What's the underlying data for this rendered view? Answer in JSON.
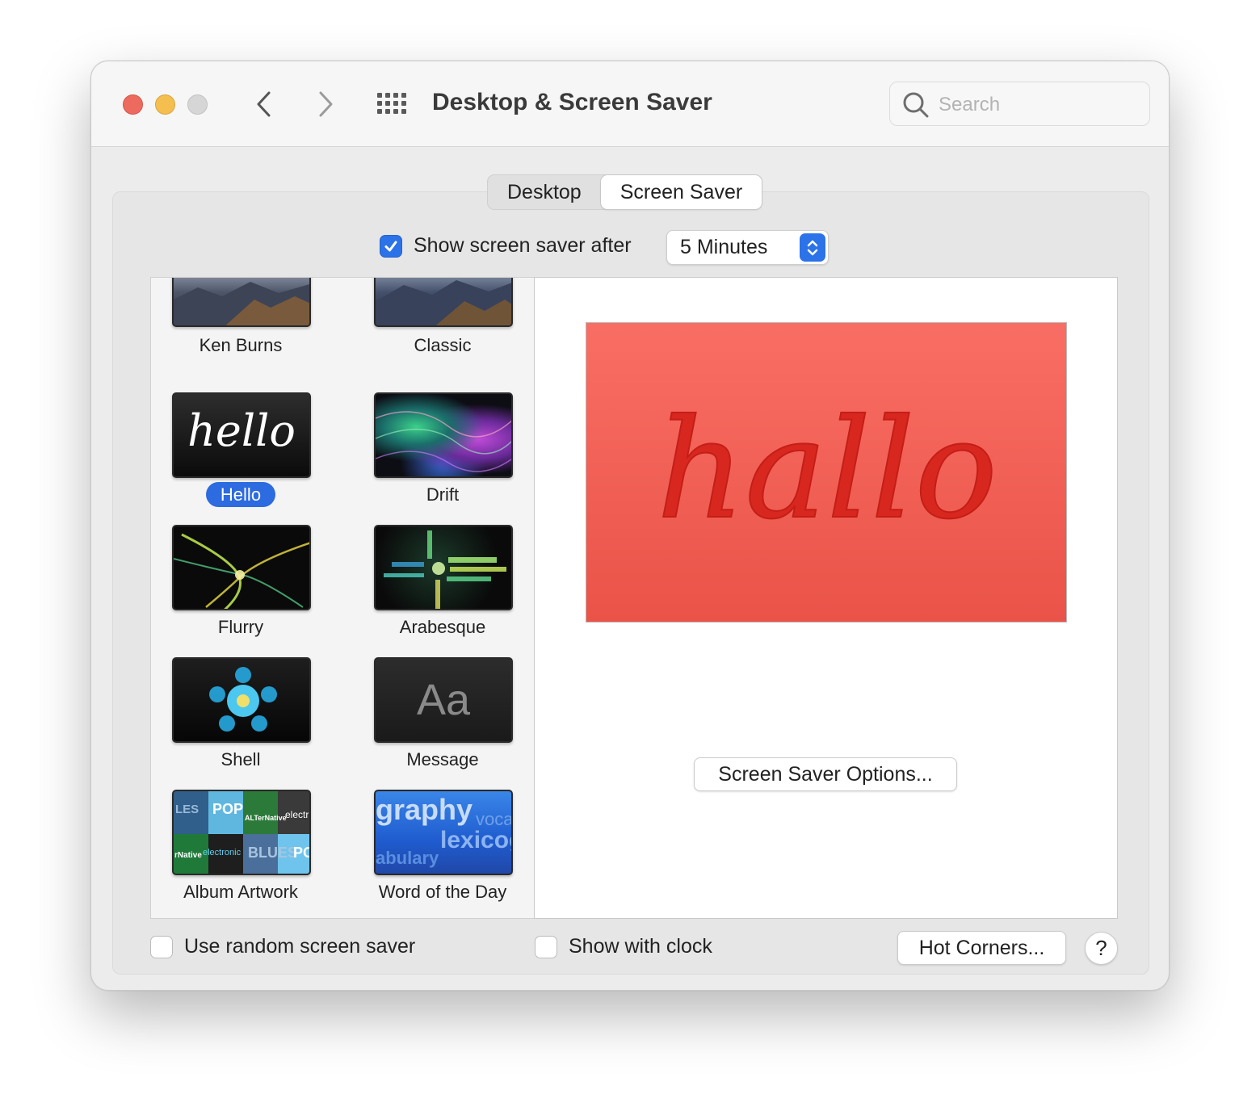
{
  "window": {
    "title": "Desktop & Screen Saver",
    "search_placeholder": "Search"
  },
  "tabs": [
    {
      "label": "Desktop",
      "active": false
    },
    {
      "label": "Screen Saver",
      "active": true
    }
  ],
  "show_after": {
    "label": "Show screen saver after",
    "checked": true,
    "selected_value": "5 Minutes"
  },
  "savers": [
    {
      "label": "Ken Burns",
      "selected": false
    },
    {
      "label": "Classic",
      "selected": false
    },
    {
      "label": "Hello",
      "selected": true
    },
    {
      "label": "Drift",
      "selected": false
    },
    {
      "label": "Flurry",
      "selected": false
    },
    {
      "label": "Arabesque",
      "selected": false
    },
    {
      "label": "Shell",
      "selected": false
    },
    {
      "label": "Message",
      "selected": false
    },
    {
      "label": "Album Artwork",
      "selected": false
    },
    {
      "label": "Word of the Day",
      "selected": false
    }
  ],
  "thumb_text": {
    "hello": "hello",
    "message": "Aa",
    "word_main": "graphy",
    "word_small": "voca",
    "word_mid": "lexicog",
    "word_low": "abulary",
    "album_tiles": [
      "LES",
      "POP",
      "ALTerNative",
      "electr",
      "rNative",
      "electronic",
      "BLUES",
      "PO"
    ]
  },
  "preview": {
    "text": "hallo",
    "color_top": "#f96e64",
    "color_bottom": "#ea5348",
    "script_color": "#d8271f"
  },
  "buttons": {
    "options": "Screen Saver Options...",
    "hot_corners": "Hot Corners...",
    "help": "?"
  },
  "bottom_options": {
    "random_label": "Use random screen saver",
    "random_checked": false,
    "clock_label": "Show with clock",
    "clock_checked": false
  },
  "colors": {
    "accent": "#2c72e8",
    "close": "#ed6a5e",
    "minimize": "#f5bf4f",
    "zoom_disabled": "#d6d6d6"
  }
}
